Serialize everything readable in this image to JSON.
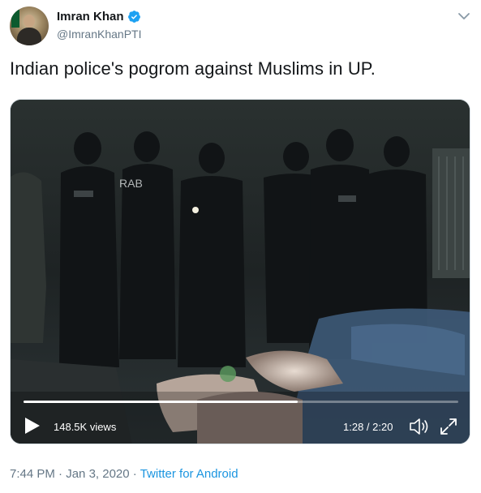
{
  "author": {
    "display_name": "Imran Khan",
    "handle": "@ImranKhanPTI",
    "avatar_icon": "profile-photo",
    "verified_icon": "verified-badge-icon"
  },
  "tweet": {
    "text": "Indian police's pogrom against Muslims in UP."
  },
  "video": {
    "views": "148.5K views",
    "time": "1:28 / 2:20",
    "progress_fraction": 0.63,
    "overlay_text": "RAB"
  },
  "meta": {
    "time": "7:44 PM",
    "separator1": " · ",
    "date": "Jan 3, 2020",
    "separator2": " · ",
    "source": "Twitter for Android"
  },
  "colors": {
    "verified": "#1da1f2",
    "link": "#1b95e0",
    "secondary_text": "#657786"
  }
}
